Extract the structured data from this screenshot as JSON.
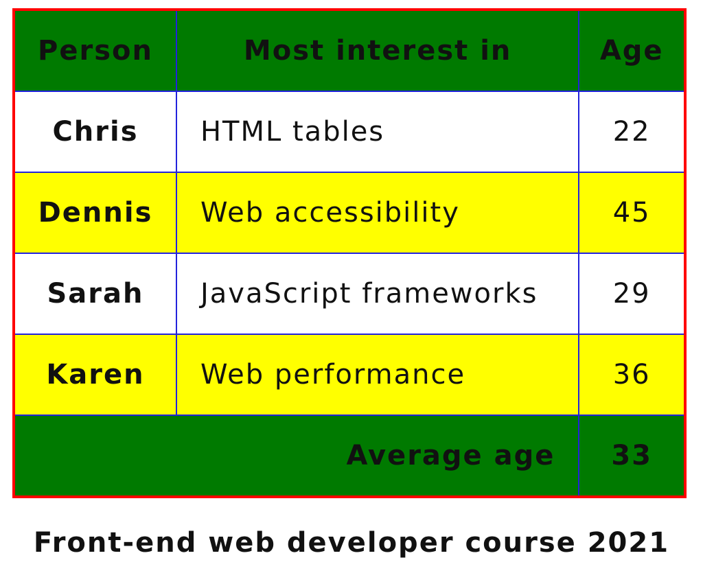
{
  "table": {
    "headers": [
      "Person",
      "Most interest in",
      "Age"
    ],
    "rows": [
      {
        "person": "Chris",
        "interest": "HTML tables",
        "age": "22"
      },
      {
        "person": "Dennis",
        "interest": "Web accessibility",
        "age": "45"
      },
      {
        "person": "Sarah",
        "interest": "JavaScript frameworks",
        "age": "29"
      },
      {
        "person": "Karen",
        "interest": "Web performance",
        "age": "36"
      }
    ],
    "footer": {
      "label": "Average age",
      "value": "33"
    }
  },
  "caption": "Front-end web developer course 2021",
  "colors": {
    "header_bg": "#007a00",
    "stripe_bg": "#ffff00",
    "outer_border": "#ff0000",
    "cell_border": "#2222dd"
  }
}
